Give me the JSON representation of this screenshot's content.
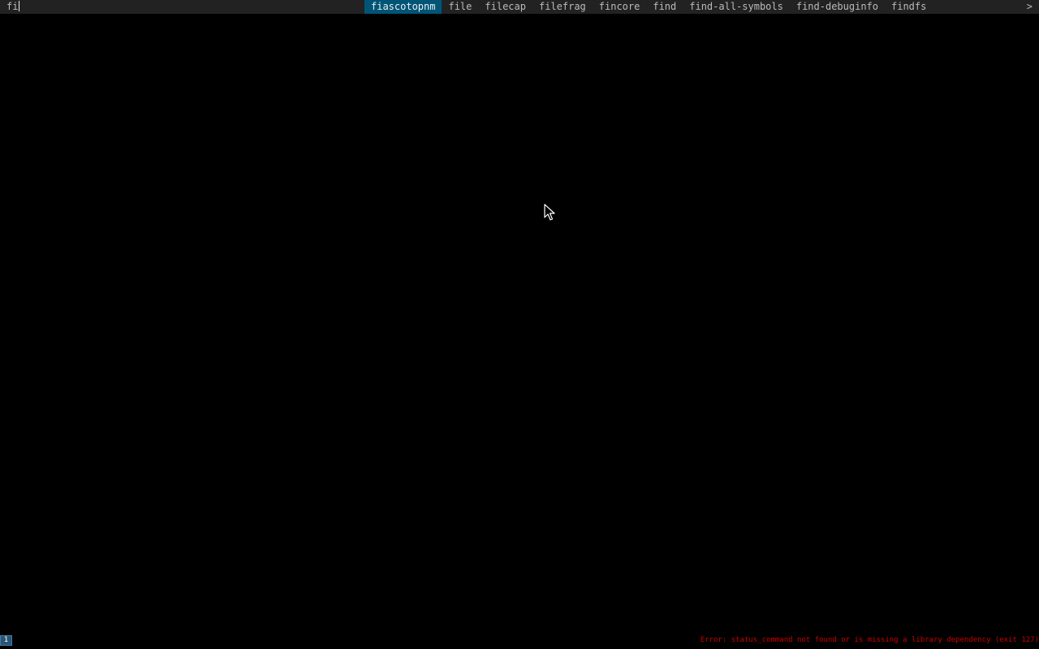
{
  "launcher": {
    "input_text": "fi",
    "items": [
      {
        "label": "fiascotopnm",
        "selected": true
      },
      {
        "label": "file",
        "selected": false
      },
      {
        "label": "filecap",
        "selected": false
      },
      {
        "label": "filefrag",
        "selected": false
      },
      {
        "label": "fincore",
        "selected": false
      },
      {
        "label": "find",
        "selected": false
      },
      {
        "label": "find-all-symbols",
        "selected": false
      },
      {
        "label": "find-debuginfo",
        "selected": false
      },
      {
        "label": "findfs",
        "selected": false
      }
    ],
    "more_indicator": ">"
  },
  "statusbar": {
    "workspace": "1",
    "error_text": "Error: status_command not found or is missing a library dependency (exit 127)"
  },
  "colors": {
    "bar_bg": "#222222",
    "bar_fg": "#bbbbbb",
    "selected_bg": "#005577",
    "selected_fg": "#eeeeee",
    "workspace_bg": "#285577",
    "error_fg": "#cc0000"
  }
}
